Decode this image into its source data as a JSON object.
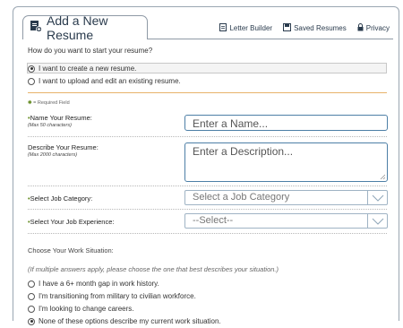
{
  "header": {
    "title": "Add a New Resume",
    "links": [
      {
        "label": "Letter Builder",
        "icon": "document-icon"
      },
      {
        "label": "Saved Resumes",
        "icon": "saved-icon"
      },
      {
        "label": "Privacy",
        "icon": "lock-icon"
      }
    ]
  },
  "start": {
    "question": "How do you want to start your resume?",
    "options": [
      {
        "label": "I want to create a new resume.",
        "selected": true
      },
      {
        "label": "I want to upload and edit an existing resume.",
        "selected": false
      }
    ]
  },
  "required_note": "= Required Field",
  "fields": {
    "name": {
      "label": "Name Your Resume:",
      "sub": "(Max 50 characters)",
      "placeholder": "Enter a Name..."
    },
    "description": {
      "label": "Describe Your Resume:",
      "sub": "(Max 2000 characters)",
      "placeholder": "Enter a Description..."
    },
    "category": {
      "label": "Select Job Category:",
      "value": "Select a Job Category"
    },
    "experience": {
      "label": "Select Your Job Experience:",
      "value": "--Select--"
    }
  },
  "situation": {
    "title": "Choose Your Work Situation:",
    "hint": "(If multiple answers apply, please choose the one that best describes your situation.)",
    "options": [
      {
        "label": "I have a 6+ month gap in work history.",
        "selected": false
      },
      {
        "label": "I'm transitioning from military to civilian workforce.",
        "selected": false
      },
      {
        "label": "I'm looking to change careers.",
        "selected": false
      },
      {
        "label": "None of these options describe my current work situation.",
        "selected": true
      }
    ]
  },
  "colors": {
    "accent": "#4d7fa6",
    "required_star": "#6a8f2a",
    "rule": "#e8b26a"
  }
}
